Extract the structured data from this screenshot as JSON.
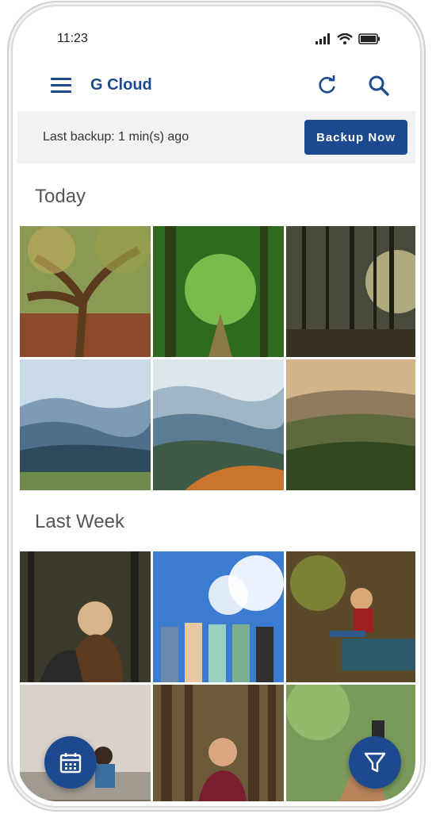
{
  "status_bar": {
    "time": "11:23"
  },
  "app_bar": {
    "title": "G Cloud"
  },
  "backup": {
    "text": "Last backup: 1 min(s) ago",
    "button_label": "Backup Now"
  },
  "sections": [
    {
      "title": "Today"
    },
    {
      "title": "Last Week"
    }
  ],
  "colors": {
    "accent": "#1d4a8f",
    "bar_bg": "#f2f2f4"
  }
}
